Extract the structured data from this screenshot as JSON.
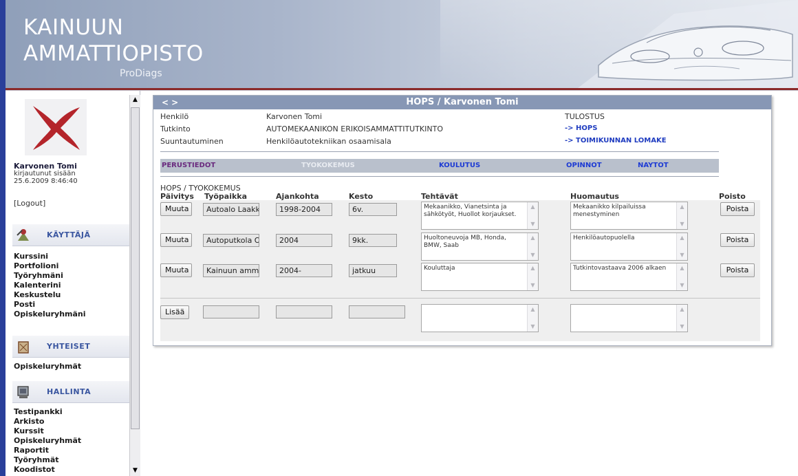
{
  "header": {
    "brand_line1": "KAINUUN",
    "brand_line2": "AMMATTIOPISTO",
    "brand_sub": "ProDiags"
  },
  "sidebar": {
    "user_name": "Karvonen Tomi",
    "user_status": "kirjautunut sisään",
    "user_date": "25.6.2009 8:46:40",
    "logout": "[Logout]",
    "sections": [
      {
        "title": "KÄYTTÄJÄ",
        "items": [
          "Kurssini",
          "Portfolioni",
          "Työryhmäni",
          "Kalenterini",
          "Keskustelu",
          "Posti",
          "Opiskeluryhmäni"
        ]
      },
      {
        "title": "YHTEISET",
        "items": [
          "Opiskeluryhmät"
        ]
      },
      {
        "title": "HALLINTA",
        "items": [
          "Testipankki",
          "Arkisto",
          "Kurssit",
          "Opiskeluryhmät",
          "Raportit",
          "Työryhmät",
          "Koodistot"
        ]
      }
    ]
  },
  "panel": {
    "title": "HOPS / Karvonen Tomi",
    "nav": "< >",
    "info": {
      "henkilo_label": "Henkilö",
      "henkilo_value": "Karvonen Tomi",
      "tutkinto_label": "Tutkinto",
      "tutkinto_value": "AUTOMEKAANIKON ERIKOISAMMATTITUTKINTO",
      "suunt_label": "Suuntautuminen",
      "suunt_value": "Henkilöautotekniikan osaamisala",
      "tulostus": "TULOSTUS",
      "link_hops": "-> HOPS",
      "link_lomake": "-> TOIMIKUNNAN LOMAKE"
    },
    "tabs": [
      "PERUSTIEDOT",
      "TYOKOKEMUS",
      "KOULUTUS",
      "OPINNOT",
      "NAYTOT"
    ],
    "section_label": "HOPS / TYOKOKEMUS",
    "columns": [
      "Päivitys",
      "Työpaikka",
      "Ajankohta",
      "Kesto",
      "Tehtävät",
      "Huomautus",
      "Poisto"
    ],
    "rows": [
      {
        "edit": "Muuta",
        "workplace": "Autoalo Laakk",
        "period": "1998-2004",
        "duration": "6v.",
        "tasks": "Mekaanikko, Vianetsinta ja sähkötyöt, Huollot korjaukset.",
        "note": "Mekaanikko kilpailuissa menestyminen",
        "delete": "Poista"
      },
      {
        "edit": "Muuta",
        "workplace": "Autoputkola Oy",
        "period": "2004",
        "duration": "9kk.",
        "tasks": "Huoltoneuvoja MB, Honda, BMW, Saab",
        "note": "Henkilöautopuolella",
        "delete": "Poista"
      },
      {
        "edit": "Muuta",
        "workplace": "Kainuun amm",
        "period": "2004-",
        "duration": "jatkuu",
        "tasks": "Kouluttaja",
        "note": "Tutkintovastaava 2006 alkaen",
        "delete": "Poista"
      }
    ],
    "add_button": "Lisää"
  }
}
